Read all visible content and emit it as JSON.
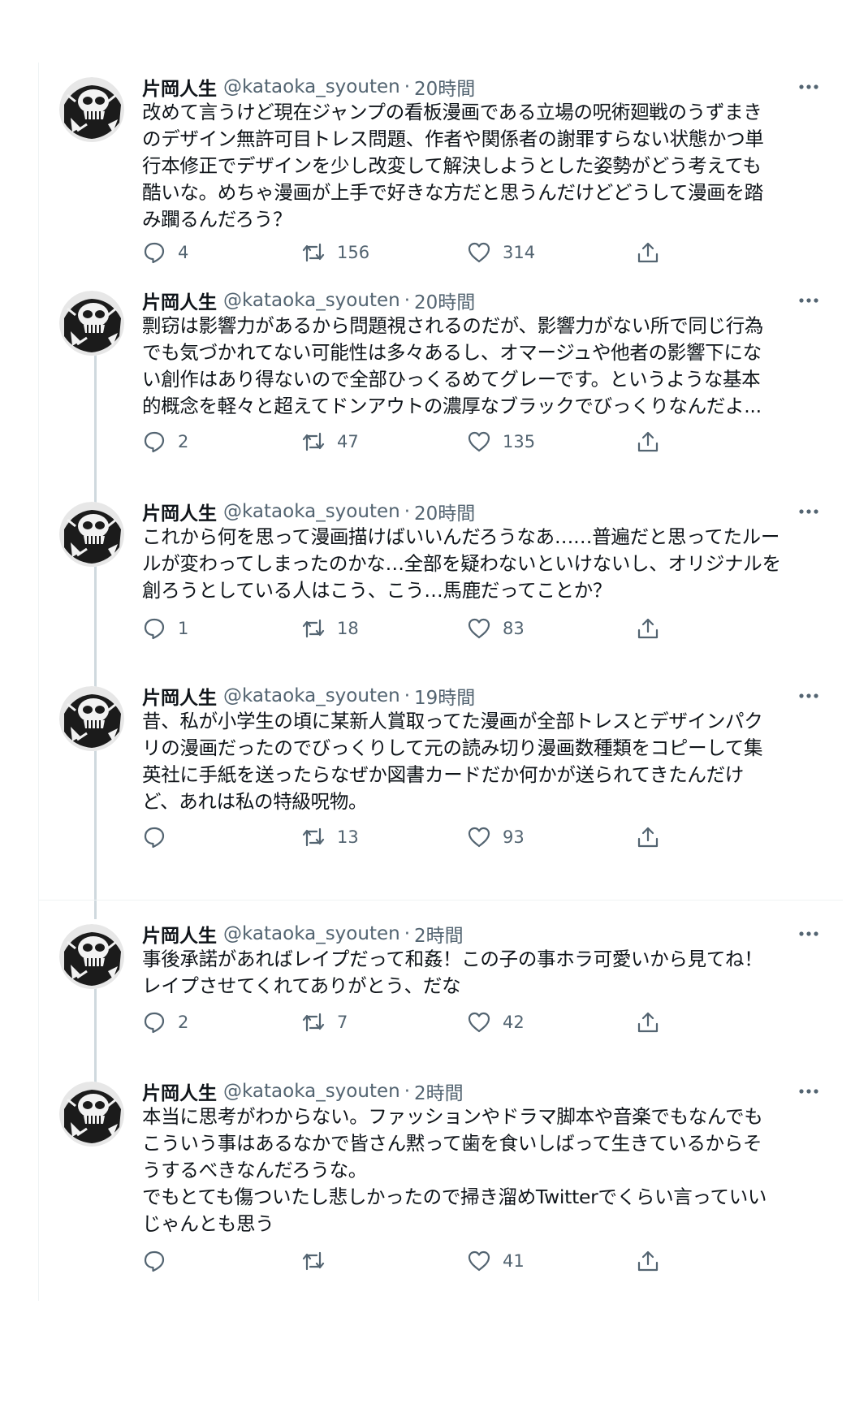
{
  "tweets": [
    {
      "name": "片岡人生",
      "handle": "@kataoka_syouten",
      "separator": "·",
      "time": "20時間",
      "text": "改めて言うけど現在ジャンプの看板漫画である立場の呪術廻戦のうずまき\nのデザイン無許可目トレス問題、作者や関係者の謝罪すらない状態かつ単\n行本修正でデザインを少し改変して解決しようとした姿勢がどう考えても\n酷いな。めちゃ漫画が上手で好きな方だと思うんだけどどうして漫画を踏\nみ躙るんだろう？",
      "replies": "4",
      "retweets": "156",
      "likes": "314"
    },
    {
      "name": "片岡人生",
      "handle": "@kataoka_syouten",
      "separator": "·",
      "time": "20時間",
      "text": "剽窃は影響力があるから問題視されるのだが、影響力がない所で同じ行為\nでも気づかれてない可能性は多々あるし、オマージュや他者の影響下にな\nい創作はあり得ないので全部ひっくるめてグレーです。というような基本\n的概念を軽々と超えてドンアウトの濃厚なブラックでびっくりなんだよ...",
      "replies": "2",
      "retweets": "47",
      "likes": "135"
    },
    {
      "name": "片岡人生",
      "handle": "@kataoka_syouten",
      "separator": "·",
      "time": "20時間",
      "text": "これから何を思って漫画描けばいいんだろうなあ……普遍だと思ってたルー\nルが変わってしまったのかな…全部を疑わないといけないし、オリジナルを\n創ろうとしている人はこう、こう…馬鹿だってことか？",
      "replies": "1",
      "retweets": "18",
      "likes": "83"
    },
    {
      "name": "片岡人生",
      "handle": "@kataoka_syouten",
      "separator": "·",
      "time": "19時間",
      "text": "昔、私が小学生の頃に某新人賞取ってた漫画が全部トレスとデザインパク\nリの漫画だったのでびっくりして元の読み切り漫画数種類をコピーして集\n英社に手紙を送ったらなぜか図書カードだか何かが送られてきたんだけ\nど、あれは私の特級呪物。",
      "replies": "",
      "retweets": "13",
      "likes": "93"
    },
    {
      "name": "片岡人生",
      "handle": "@kataoka_syouten",
      "separator": "·",
      "time": "2時間",
      "text": "事後承諾があればレイプだって和姦！この子の事ホラ可愛いから見てね！\nレイプさせてくれてありがとう、だな",
      "replies": "2",
      "retweets": "7",
      "likes": "42"
    },
    {
      "name": "片岡人生",
      "handle": "@kataoka_syouten",
      "separator": "·",
      "time": "2時間",
      "text": "本当に思考がわからない。ファッションやドラマ脚本や音楽でもなんでも\nこういう事はあるなかで皆さん黙って歯を食いしばって生きているからそ\nうするべきなんだろうな。\nでもとても傷ついたし悲しかったので掃き溜めTwitterでくらい言っていい\nじゃんとも思う",
      "replies": "",
      "retweets": "",
      "likes": "41"
    }
  ],
  "icons": {
    "avatar": "skull-avatar-icon",
    "more": "more-horizontal-icon",
    "reply": "reply-icon",
    "retweet": "retweet-icon",
    "like": "heart-icon",
    "share": "share-icon"
  },
  "colors": {
    "text": "#0f1419",
    "secondary": "#536471",
    "thread_line": "#cfd9de",
    "divider": "#eff3f4"
  }
}
